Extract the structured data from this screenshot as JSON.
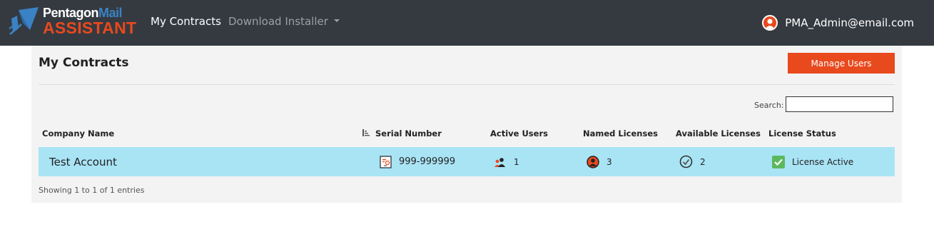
{
  "brand": {
    "line1_main": "Pentagon",
    "line1_accent": "Mail",
    "line2": "ASSISTANT",
    "colors": {
      "nav_bg": "#353a41",
      "accent": "#e8491d",
      "blue": "#3b82c4"
    }
  },
  "nav": {
    "my_contracts": "My Contracts",
    "download_installer": "Download Installer",
    "user_email": "PMA_Admin@email.com",
    "user_icon": "user-avatar-icon"
  },
  "page": {
    "title": "My Contracts",
    "manage_users": "Manage Users",
    "search_label": "Search:",
    "search_value": "",
    "footer": "Showing 1 to 1 of 1 entries"
  },
  "table": {
    "columns": [
      "Company Name",
      "Serial Number",
      "Active Users",
      "Named Licenses",
      "Available Licenses",
      "License Status"
    ],
    "rows": [
      {
        "company": "Test Account",
        "serial": "999-999999",
        "active_users": "1",
        "named_licenses": "3",
        "available_licenses": "2",
        "status": "License Active",
        "row_color": "#a9e4f5"
      }
    ]
  }
}
